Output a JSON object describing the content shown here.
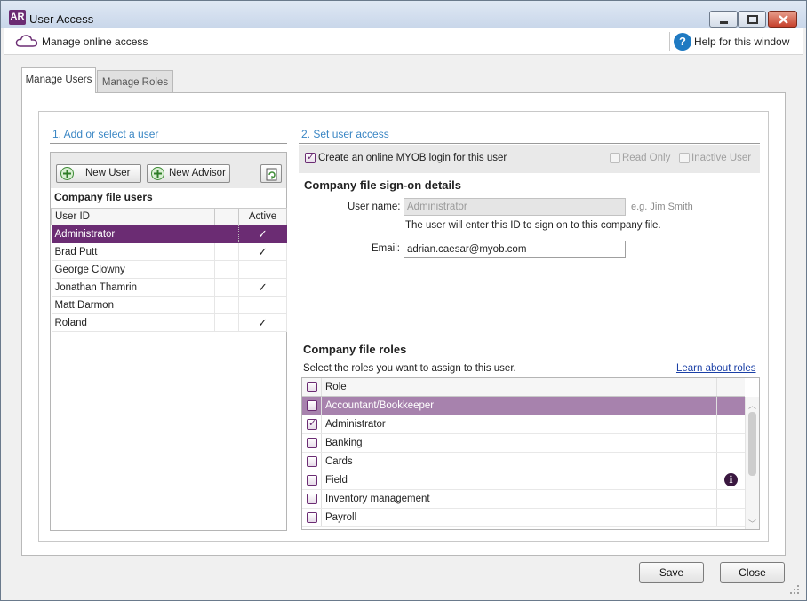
{
  "window": {
    "app_icon_text": "AR",
    "title": "User Access"
  },
  "subbar": {
    "manage_online": "Manage online access",
    "help": "Help for this window",
    "help_icon_text": "?"
  },
  "tabs": [
    {
      "label": "Manage Users"
    },
    {
      "label": "Manage Roles"
    }
  ],
  "left": {
    "heading": "1. Add or select a user",
    "new_user": "New User",
    "new_advisor": "New Advisor",
    "subheading": "Company file users",
    "columns": {
      "user_id": "User ID",
      "active": "Active"
    },
    "users": [
      {
        "id": "Administrator",
        "active": "✓"
      },
      {
        "id": "Brad Putt",
        "active": "✓"
      },
      {
        "id": "George Clowny",
        "active": ""
      },
      {
        "id": "Jonathan Thamrin",
        "active": "✓"
      },
      {
        "id": "Matt Darmon",
        "active": ""
      },
      {
        "id": "Roland",
        "active": "✓"
      }
    ]
  },
  "right": {
    "heading": "2. Set user access",
    "create_login": "Create an online MYOB login for this user",
    "read_only": "Read Only",
    "inactive_user": "Inactive User",
    "signon_heading": "Company file sign-on details",
    "username_label": "User name:",
    "username_value": "Administrator",
    "username_hint": "e.g. Jim Smith",
    "username_note": "The user will enter this ID to sign on to this company file.",
    "email_label": "Email:",
    "email_value": "adrian.caesar@myob.com",
    "roles_heading": "Company file roles",
    "roles_note": "Select the roles you want to assign to this user.",
    "learn_link": "Learn about roles",
    "roles_column": "Role",
    "info_icon_text": "i",
    "roles": [
      {
        "name": "Accountant/Bookkeeper",
        "checked": false
      },
      {
        "name": "Administrator",
        "checked": true
      },
      {
        "name": "Banking",
        "checked": false
      },
      {
        "name": "Cards",
        "checked": false
      },
      {
        "name": "Field",
        "checked": false
      },
      {
        "name": "Inventory management",
        "checked": false
      },
      {
        "name": "Payroll",
        "checked": false
      }
    ]
  },
  "footer": {
    "save": "Save",
    "close": "Close"
  },
  "colors": {
    "brand_purple": "#6b2c73",
    "selected_role": "#a782ad",
    "section_blue": "#3a86c4",
    "link_blue": "#1a3fa6"
  }
}
